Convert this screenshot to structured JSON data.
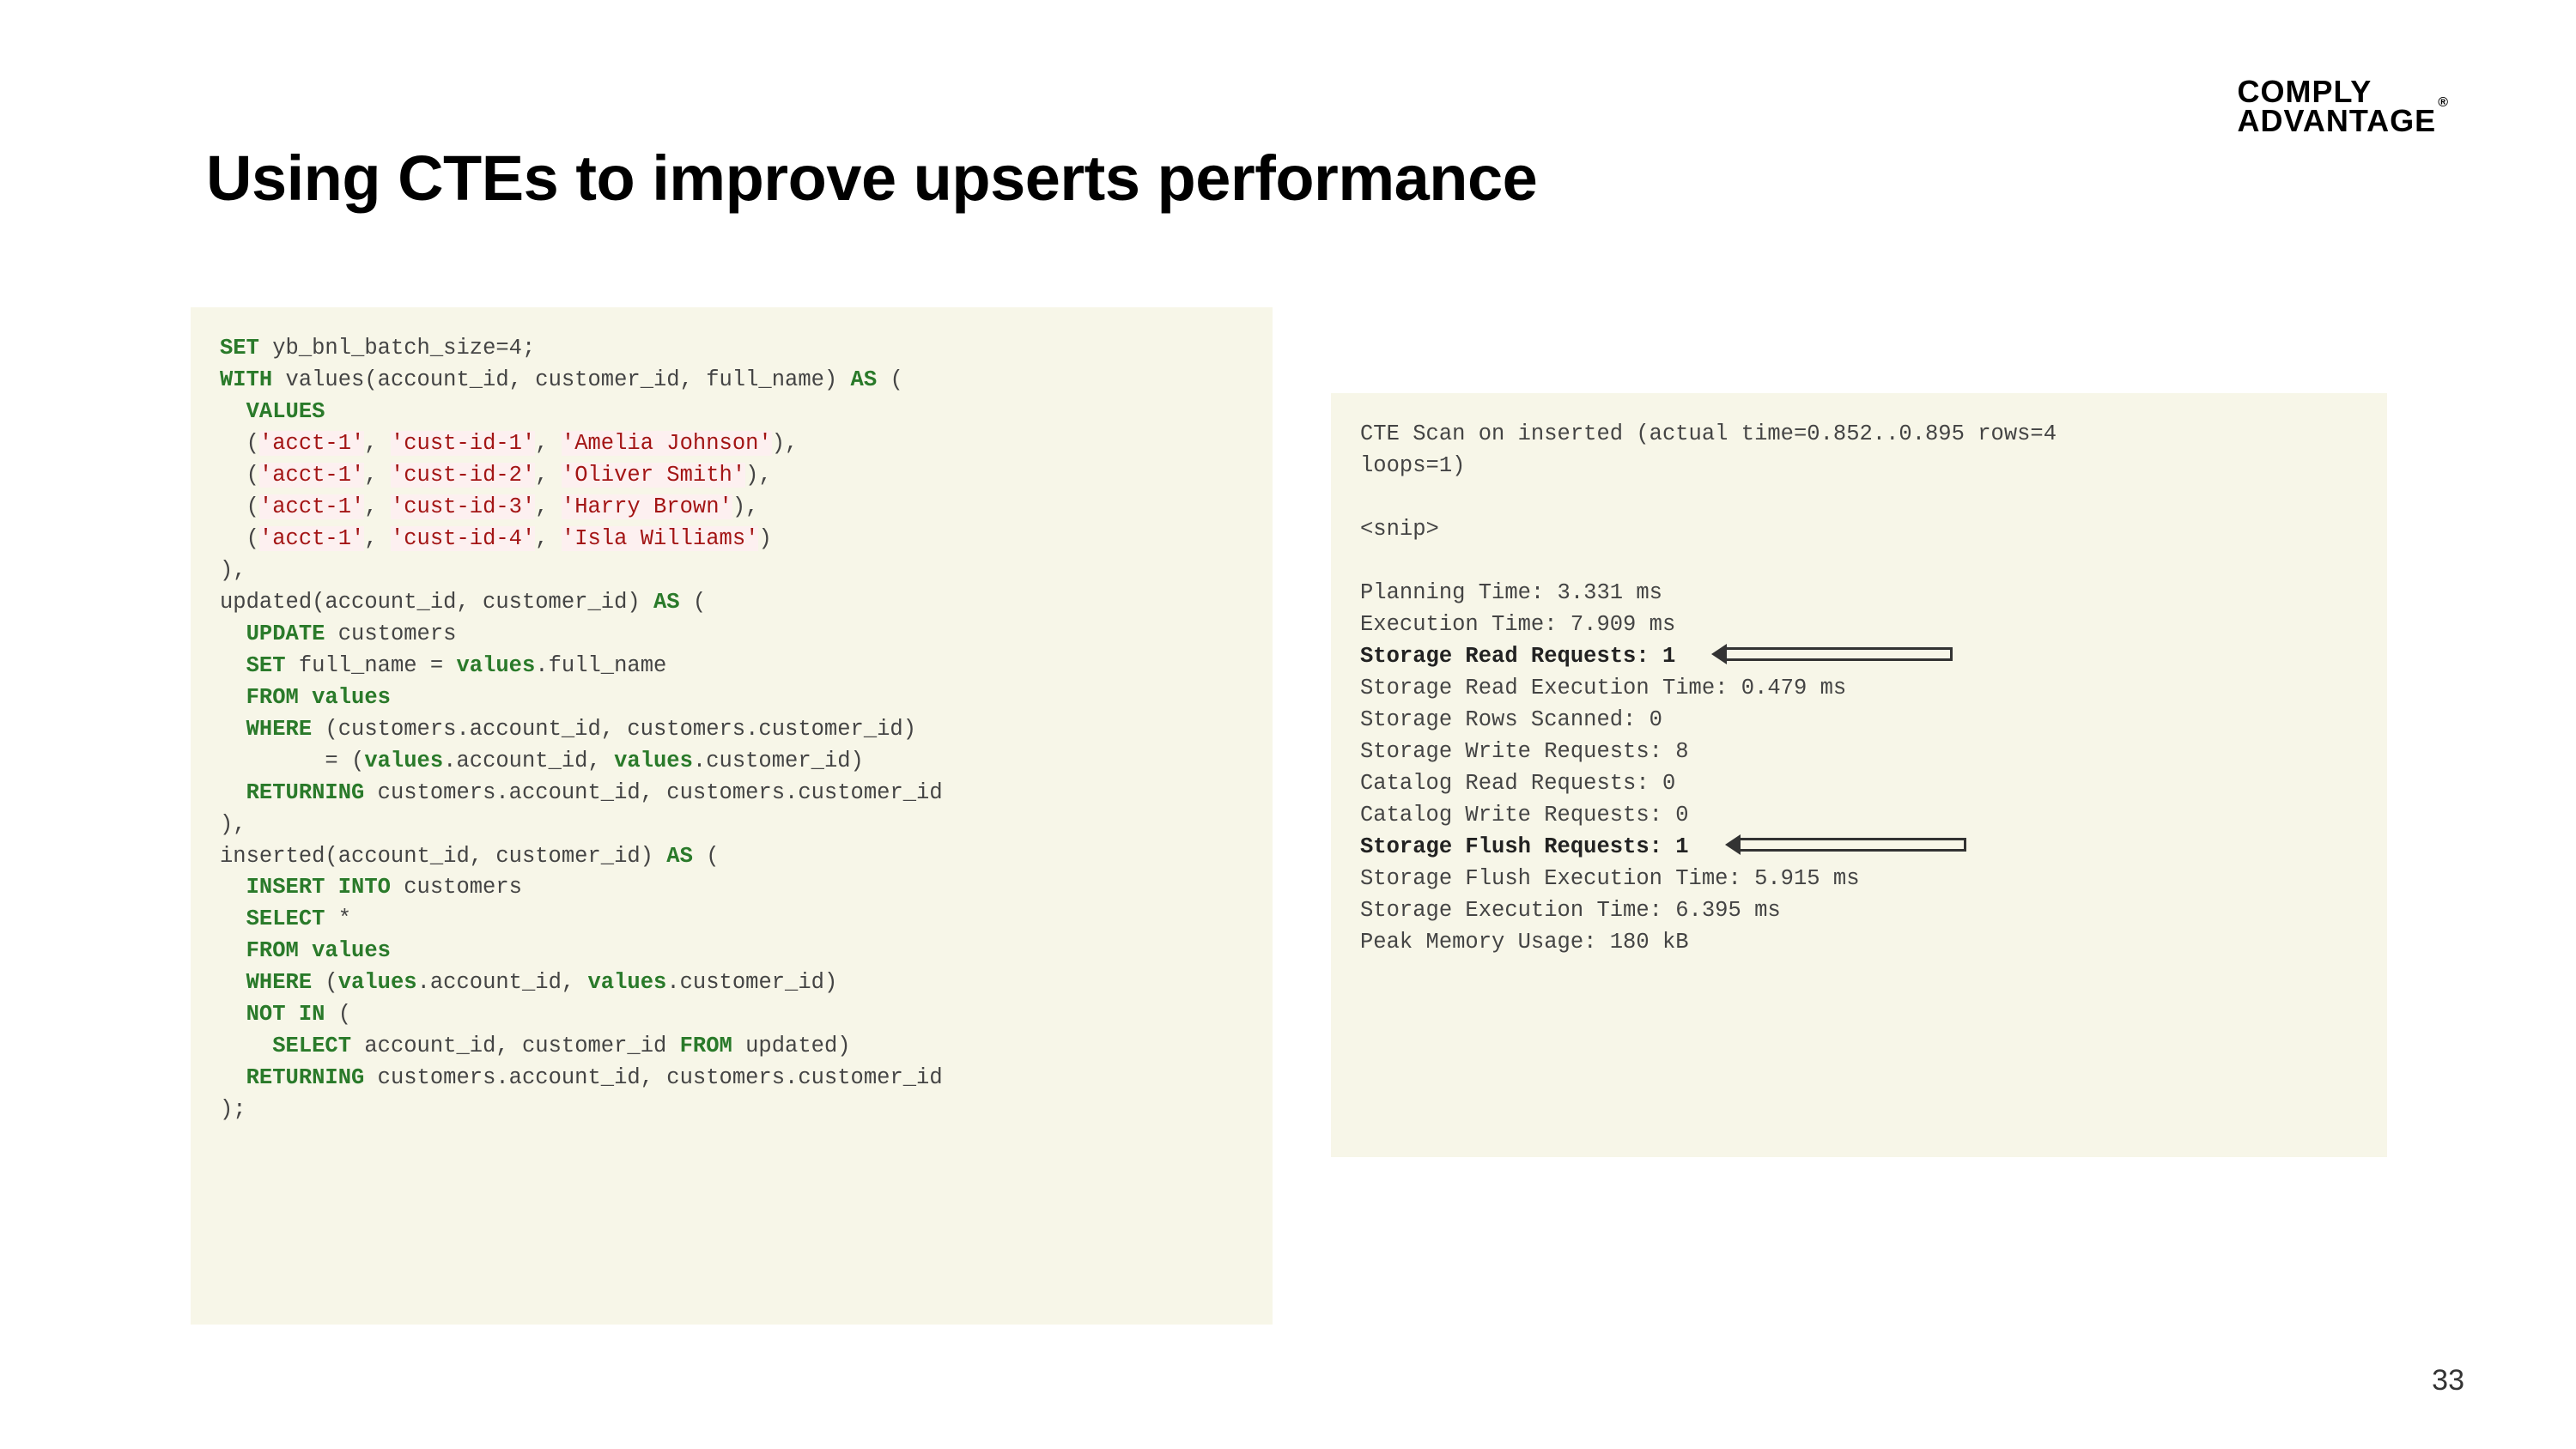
{
  "logo": {
    "line1": "COMPLY",
    "line2": "ADVANTAGE",
    "reg": "®"
  },
  "title": "Using CTEs to improve upserts performance",
  "page_number": "33",
  "sql": {
    "set_line": {
      "kw": "SET",
      "rest": " yb_bnl_batch_size=4;"
    },
    "with_line": {
      "kw": "WITH",
      "mid": " values(account_id, customer_id, full_name) ",
      "as": "AS",
      "tail": " ("
    },
    "values_kw": "VALUES",
    "rows": [
      {
        "a": "'acct-1'",
        "b": "'cust-id-1'",
        "c": "'Amelia Johnson'"
      },
      {
        "a": "'acct-1'",
        "b": "'cust-id-2'",
        "c": "'Oliver Smith'"
      },
      {
        "a": "'acct-1'",
        "b": "'cust-id-3'",
        "c": "'Harry Brown'"
      },
      {
        "a": "'acct-1'",
        "b": "'cust-id-4'",
        "c": "'Isla Williams'"
      }
    ],
    "close1": "),",
    "updated_head": {
      "pre": "updated(account_id, customer_id) ",
      "as": "AS",
      "tail": " ("
    },
    "update_kw": "UPDATE",
    "update_tbl": " customers",
    "set_kw": "SET",
    "set_mid": " full_name = ",
    "set_vals": "values",
    "set_tail": ".full_name",
    "from_kw": "FROM",
    "from_vals": " values",
    "where_kw": "WHERE",
    "where_tail": " (customers.account_id, customers.customer_id)",
    "where_eq_pre": "        = (",
    "where_eq_v1": "values",
    "where_eq_mid": ".account_id, ",
    "where_eq_v2": "values",
    "where_eq_tail": ".customer_id)",
    "returning_kw": "RETURNING",
    "returning_tail": " customers.account_id, customers.customer_id",
    "close2": "),",
    "inserted_head": {
      "pre": "inserted(account_id, customer_id) ",
      "as": "AS",
      "tail": " ("
    },
    "insert_kw": "INSERT INTO",
    "insert_tbl": " customers",
    "select_kw": "SELECT",
    "select_tail": " *",
    "from2_kw": "FROM",
    "from2_vals": " values",
    "where2_kw": "WHERE",
    "where2_pre": " (",
    "where2_v1": "values",
    "where2_mid1": ".account_id, ",
    "where2_v2": "values",
    "where2_tail": ".customer_id)",
    "notin_kw": "NOT IN",
    "notin_tail": " (",
    "sub_select_kw": "SELECT",
    "sub_select_mid": " account_id, customer_id ",
    "sub_from_kw": "FROM",
    "sub_from_tail": " updated)",
    "returning2_kw": "RETURNING",
    "returning2_tail": " customers.account_id, customers.customer_id",
    "close3": ");"
  },
  "plan": {
    "l1": "CTE Scan on inserted (actual time=0.852..0.895 rows=4",
    "l2": "loops=1)",
    "blank1": "",
    "l3": "<snip>",
    "blank2": "",
    "l4": "Planning Time: 3.331 ms",
    "l5": "Execution Time: 7.909 ms",
    "l6": "Storage Read Requests: 1",
    "l7": "Storage Read Execution Time: 0.479 ms",
    "l8": "Storage Rows Scanned: 0",
    "l9": "Storage Write Requests: 8",
    "l10": "Catalog Read Requests: 0",
    "l11": "Catalog Write Requests: 0",
    "l12": "Storage Flush Requests: 1",
    "l13": "Storage Flush Execution Time: 5.915 ms",
    "l14": "Storage Execution Time: 6.395 ms",
    "l15": "Peak Memory Usage: 180 kB"
  }
}
